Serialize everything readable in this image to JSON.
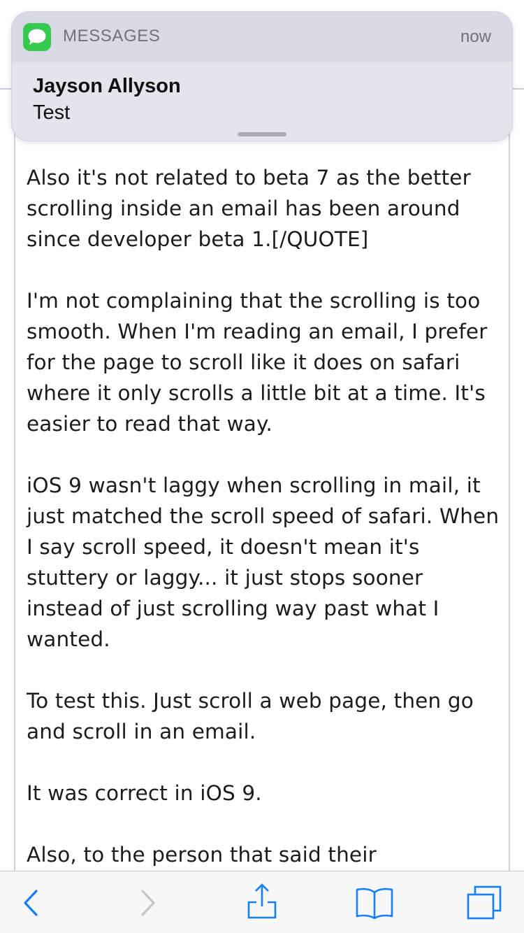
{
  "notification": {
    "app_name": "MESSAGES",
    "time": "now",
    "sender": "Jayson Allyson",
    "message": "Test",
    "app_icon": "messages-bubble-icon",
    "accent_color": "#35c94d"
  },
  "post": {
    "paragraphs": [
      "Also it's not related to beta 7 as the better scrolling inside an email has been around since developer beta 1.[/QUOTE]",
      "I'm not complaining that the scrolling is too smooth. When I'm reading an email, I prefer for the page to scroll like it does on safari where it only scrolls a little bit at a time. It's easier to read that way.",
      "iOS 9 wasn't laggy when scrolling in mail, it just matched the scroll speed of safari. When I say scroll speed, it doesn't mean it's stuttery or laggy... it just stops sooner instead of just scrolling way past what I wanted.",
      "To test this. Just scroll a web page, then go and scroll in an email.",
      "It was correct in iOS 9.",
      "Also, to the person that said their"
    ]
  },
  "toolbar": {
    "back_icon": "chevron-left-icon",
    "forward_icon": "chevron-right-icon",
    "share_icon": "share-icon",
    "bookmarks_icon": "book-icon",
    "tabs_icon": "tabs-icon",
    "tint_color": "#157efb",
    "disabled_color": "#c4c6cb"
  }
}
